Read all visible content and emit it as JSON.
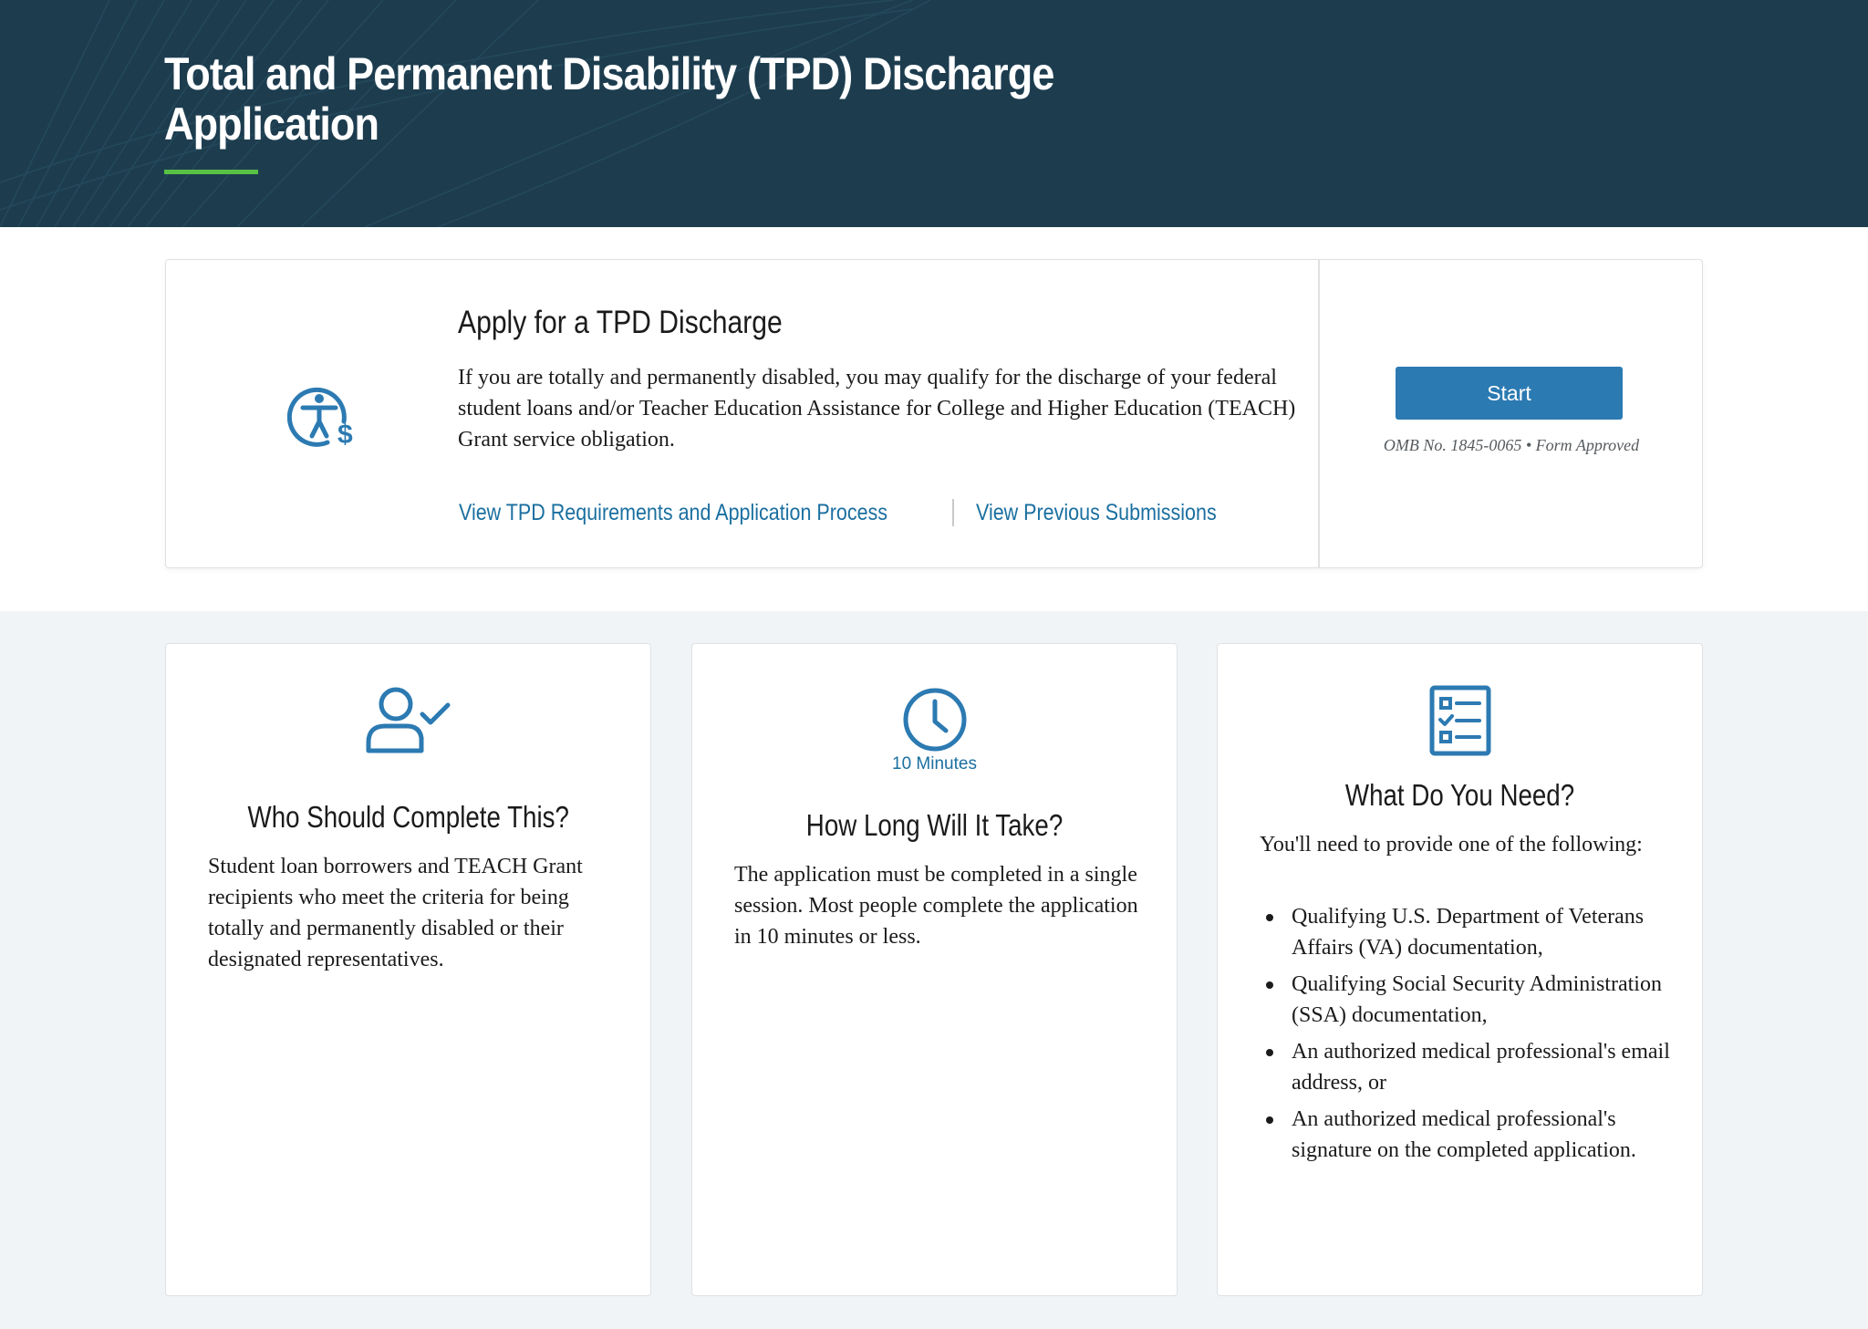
{
  "hero": {
    "title_line1": "Total and Permanent Disability (TPD) Discharge",
    "title_line2": "Application",
    "accent_color": "#58c143",
    "background_color": "#1d3d4f"
  },
  "apply": {
    "icon": "accessibility-dollar-icon",
    "heading": "Apply for a TPD Discharge",
    "description": "If you are totally and permanently disabled, you may qualify for the discharge of your federal student loans and/or Teacher Education Assistance for College and Higher Education (TEACH) Grant service obligation.",
    "links": [
      {
        "label": "View TPD Requirements and Application Process"
      },
      {
        "label": "View Previous Submissions"
      }
    ],
    "start_label": "Start",
    "omb_text": "OMB No. 1845-0065 • Form Approved",
    "button_color": "#2c7ab2"
  },
  "cards": [
    {
      "icon": "user-check-icon",
      "title": "Who Should Complete This?",
      "body": "Student loan borrowers and TEACH Grant recipients who meet the criteria for being totally and permanently disabled or their designated representatives."
    },
    {
      "icon": "clock-icon",
      "icon_label": "10 Minutes",
      "title": "How Long Will It Take?",
      "body": "The application must be completed in a single session. Most people complete the application in 10 minutes or less."
    },
    {
      "icon": "checklist-icon",
      "title": "What Do You Need?",
      "intro": "You'll need to provide one of the following:",
      "items": [
        "Qualifying U.S. Department of Veterans Affairs (VA) documentation,",
        "Qualifying Social Security Administration (SSA) documentation,",
        "An authorized medical professional's email address, or",
        "An authorized medical professional's signature on the completed application."
      ]
    }
  ],
  "link_color": "#1a6fa0"
}
